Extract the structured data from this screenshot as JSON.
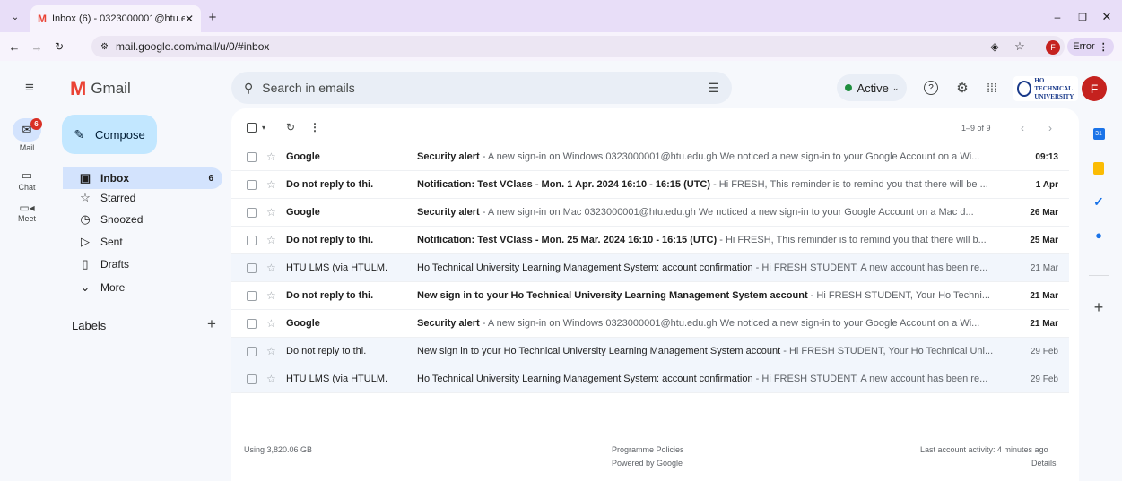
{
  "browser": {
    "tab_title": "Inbox (6) - 0323000001@htu.e",
    "url": "mail.google.com/mail/u/0/#inbox",
    "profile_initial": "F",
    "error_label": "Error"
  },
  "header": {
    "app_name": "Gmail",
    "search_placeholder": "Search in emails",
    "status_label": "Active",
    "org_logo_line1": "HO TECHNICAL",
    "org_logo_line2": "UNIVERSITY",
    "avatar_initial": "F"
  },
  "rail": {
    "mail_label": "Mail",
    "mail_badge": "6",
    "chat_label": "Chat",
    "meet_label": "Meet"
  },
  "sidebar": {
    "compose_label": "Compose",
    "items": [
      {
        "label": "Inbox",
        "count": "6",
        "icon": "inbox-icon"
      },
      {
        "label": "Starred",
        "count": "",
        "icon": "star-icon"
      },
      {
        "label": "Snoozed",
        "count": "",
        "icon": "clock-icon"
      },
      {
        "label": "Sent",
        "count": "",
        "icon": "send-icon"
      },
      {
        "label": "Drafts",
        "count": "",
        "icon": "draft-icon"
      },
      {
        "label": "More",
        "count": "",
        "icon": "chevron-down-icon"
      }
    ],
    "labels_heading": "Labels"
  },
  "toolbar": {
    "pagination": "1–9 of 9"
  },
  "emails": [
    {
      "sender": "Google",
      "subject": "Security alert",
      "snippet": " - A new sign-in on Windows 0323000001@htu.edu.gh We noticed a new sign-in to your Google Account on a Wi...",
      "date": "09:13",
      "unread": true
    },
    {
      "sender": "Do not reply to thi.",
      "subject": "Notification: Test VClass - Mon. 1 Apr. 2024 16:10 - 16:15 (UTC)",
      "snippet": " - Hi FRESH, This reminder is to remind you that there will be ...",
      "date": "1 Apr",
      "unread": true
    },
    {
      "sender": "Google",
      "subject": "Security alert",
      "snippet": " - A new sign-in on Mac 0323000001@htu.edu.gh We noticed a new sign-in to your Google Account on a Mac d...",
      "date": "26 Mar",
      "unread": true
    },
    {
      "sender": "Do not reply to thi.",
      "subject": "Notification: Test VClass - Mon. 25 Mar. 2024 16:10 - 16:15 (UTC)",
      "snippet": " - Hi FRESH, This reminder is to remind you that there will b...",
      "date": "25 Mar",
      "unread": true
    },
    {
      "sender": "HTU LMS (via HTULM.",
      "subject": "Ho Technical University Learning Management System: account confirmation",
      "snippet": " - Hi FRESH STUDENT, A new account has been re...",
      "date": "21 Mar",
      "unread": false
    },
    {
      "sender": "Do not reply to thi.",
      "subject": "New sign in to your Ho Technical University Learning Management System account",
      "snippet": " - Hi FRESH STUDENT, Your Ho Techni...",
      "date": "21 Mar",
      "unread": true
    },
    {
      "sender": "Google",
      "subject": "Security alert",
      "snippet": " - A new sign-in on Windows 0323000001@htu.edu.gh We noticed a new sign-in to your Google Account on a Wi...",
      "date": "21 Mar",
      "unread": true
    },
    {
      "sender": "Do not reply to thi.",
      "subject": "New sign in to your Ho Technical University Learning Management System account",
      "snippet": " - Hi FRESH STUDENT, Your Ho Technical Uni...",
      "date": "29 Feb",
      "unread": false
    },
    {
      "sender": "HTU LMS (via HTULM.",
      "subject": "Ho Technical University Learning Management System: account confirmation",
      "snippet": " - Hi FRESH STUDENT, A new account has been re...",
      "date": "29 Feb",
      "unread": false
    }
  ],
  "footer": {
    "storage": "Using 3,820.06 GB",
    "policies": "Programme Policies",
    "powered": "Powered by Google",
    "activity": "Last account activity: 4 minutes ago",
    "details": "Details"
  },
  "colors": {
    "compose_bg": "#c2e7ff",
    "selected_nav": "#d3e3fd",
    "active_dot": "#1e8e3e",
    "badge": "#d93025",
    "profile": "#c5221f"
  }
}
